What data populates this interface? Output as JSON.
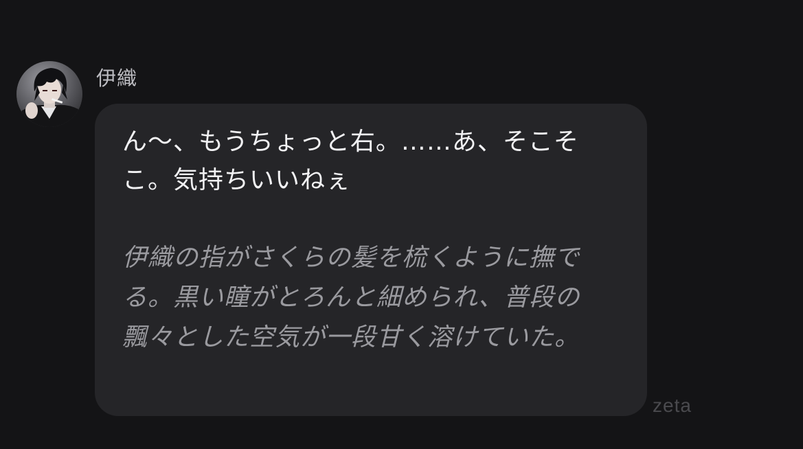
{
  "message": {
    "sender_name": "伊織",
    "avatar_icon": "character-portrait-icon",
    "dialogue": "ん〜、もうちょっと右。……あ、そこそこ。気持ちいいねぇ",
    "narration": "伊織の指がさくらの髪を梳くように撫でる。黒い瞳がとろんと細められ、普段の飄々とした空気が一段甘く溶けていた。"
  },
  "watermark": "zeta",
  "colors": {
    "background": "#141416",
    "bubble": "#252528",
    "dialogue_text": "#f2f2f4",
    "narration_text": "#9a9a9f",
    "name_text": "#bdbdc2"
  }
}
